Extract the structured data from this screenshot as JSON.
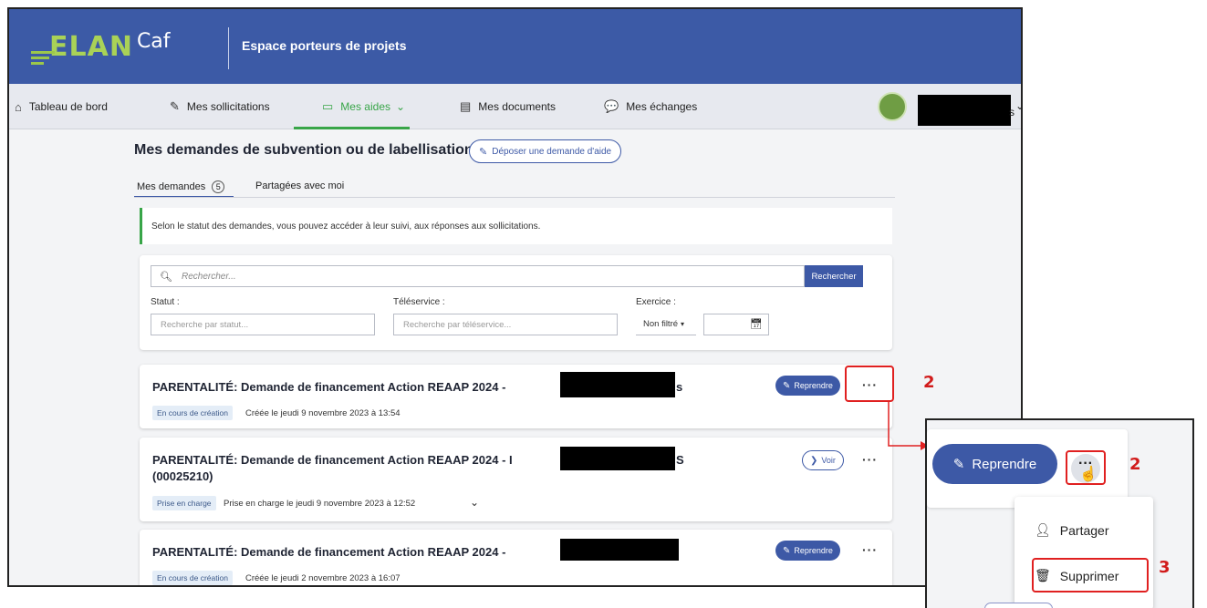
{
  "brand": {
    "logo_main": "ELAN",
    "logo_caf": "Caf",
    "subtitle": "Espace porteurs de projets"
  },
  "nav": {
    "items": [
      {
        "label": "Tableau de bord",
        "icon": "home-icon"
      },
      {
        "label": "Mes sollicitations",
        "icon": "pen-icon"
      },
      {
        "label": "Mes aides",
        "icon": "folder-icon"
      },
      {
        "label": "Mes documents",
        "icon": "document-icon"
      },
      {
        "label": "Mes échanges",
        "icon": "chat-icon"
      }
    ],
    "user_trail": "s"
  },
  "main": {
    "title": "Mes demandes de subvention ou de labellisation",
    "deposit_button": "Déposer une demande d'aide",
    "tabs": [
      {
        "label": "Mes demandes",
        "count": "5"
      },
      {
        "label": "Partagées avec moi"
      }
    ],
    "info_text": "Selon le statut des demandes, vous pouvez accéder à leur suivi, aux réponses aux sollicitations."
  },
  "search": {
    "placeholder": "Rechercher...",
    "button": "Rechercher",
    "statut_label": "Statut :",
    "statut_placeholder": "Recherche par statut...",
    "teleservice_label": "Téléservice :",
    "teleservice_placeholder": "Recherche par téléservice...",
    "exercice_label": "Exercice :",
    "exercice_select": "Non filtré"
  },
  "cards": [
    {
      "title": "PARENTALITÉ: Demande de financement Action REAAP 2024 -",
      "title_tail": "s",
      "badge": "En cours de création",
      "meta": "Créée le jeudi 9 novembre 2023 à 13:54",
      "action": "Reprendre"
    },
    {
      "title": "PARENTALITÉ: Demande de financement Action REAAP 2024 - I",
      "title_tail": "S",
      "title_line2": "(00025210)",
      "badge": "Prise en charge",
      "meta": "Prise en charge le jeudi 9 novembre 2023 à 12:52",
      "action": "Voir"
    },
    {
      "title": "PARENTALITÉ: Demande de financement Action REAAP 2024 -",
      "badge": "En cours de création",
      "meta": "Créée le jeudi 2 novembre 2023 à 16:07",
      "action": "Reprendre"
    }
  ],
  "more_glyph": "···",
  "zoom": {
    "reprendre": "Reprendre",
    "menu": [
      {
        "label": "Partager",
        "icon": "share-user-icon"
      },
      {
        "label": "Supprimer",
        "icon": "trash-icon"
      }
    ]
  },
  "annotations": {
    "step_2": "2",
    "step_3": "3"
  },
  "colors": {
    "header": "#3c5aa6",
    "accent_green": "#38a548",
    "primary_blue": "#3d59a6",
    "annotation_red": "#e02020"
  }
}
